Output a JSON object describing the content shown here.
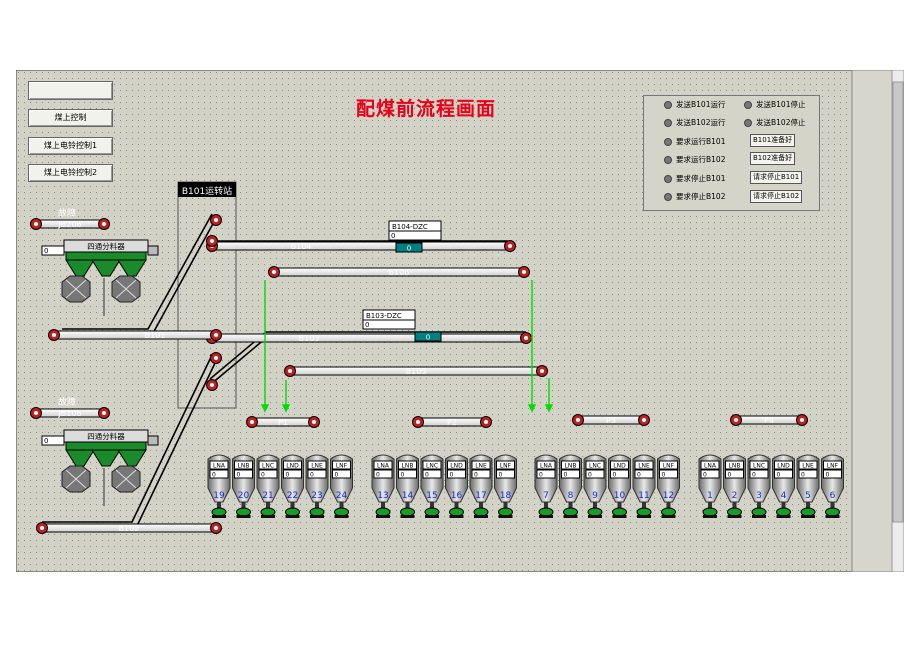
{
  "title": "配煤前流程画面",
  "side_buttons": [
    "",
    "煤上控制",
    "煤上电铃控制1",
    "煤上电铃控制2"
  ],
  "station_label": "B101运转站",
  "status_panel": {
    "left": [
      "发送B101运行",
      "发送B102运行",
      "要求运行B101",
      "要求运行B102",
      "要求停止B101",
      "要求停止B102"
    ],
    "right_leds": [
      "发送B101停止",
      "发送B102停止"
    ],
    "right_buttons": [
      "B101准备好",
      "B102准备好",
      "请求停止B101",
      "请求停止B102"
    ]
  },
  "tags": {
    "b104_dzc": "B104-DZC",
    "b103_dzc": "B103-DZC",
    "zero": "0",
    "b104_value": "0",
    "b103_value": "0"
  },
  "conveyors": {
    "b104": "B104",
    "b106": "B106",
    "b103": "B103",
    "b105": "B105",
    "b101": "B101",
    "b102": "B102",
    "p1": "P1",
    "p2": "P2",
    "p3": "P3",
    "p4": "P4",
    "fault1": "故障",
    "fault2": "故障",
    "top1": "JB206",
    "top2": "JB106"
  },
  "feeders": [
    "四通分料器",
    "四通分料器"
  ],
  "bunker_groups": [
    {
      "tags": [
        "LNA",
        "LNB",
        "LNC",
        "LND",
        "LNE",
        "LNF"
      ],
      "numbers": [
        "19",
        "20",
        "21",
        "22",
        "23",
        "24"
      ]
    },
    {
      "tags": [
        "LNA",
        "LNB",
        "LNC",
        "LND",
        "LNE",
        "LNF"
      ],
      "numbers": [
        "13",
        "14",
        "15",
        "16",
        "17",
        "18"
      ]
    },
    {
      "tags": [
        "LNA",
        "LNB",
        "LNC",
        "LND",
        "LNE",
        "LNF"
      ],
      "numbers": [
        "7",
        "8",
        "9",
        "10",
        "11",
        "12"
      ]
    },
    {
      "tags": [
        "LNA",
        "LNB",
        "LNC",
        "LND",
        "LNE",
        "LNF"
      ],
      "numbers": [
        "1",
        "2",
        "3",
        "4",
        "5",
        "6"
      ]
    }
  ],
  "colors": {
    "bg": "#d2d2c6",
    "title": "#e8001a",
    "flow_green": "#00dd00",
    "hopper_green": "#1a8a2a",
    "value_teal": "#008080",
    "roller_red": "#c02020",
    "bunker_number": "#1a2ccf"
  }
}
